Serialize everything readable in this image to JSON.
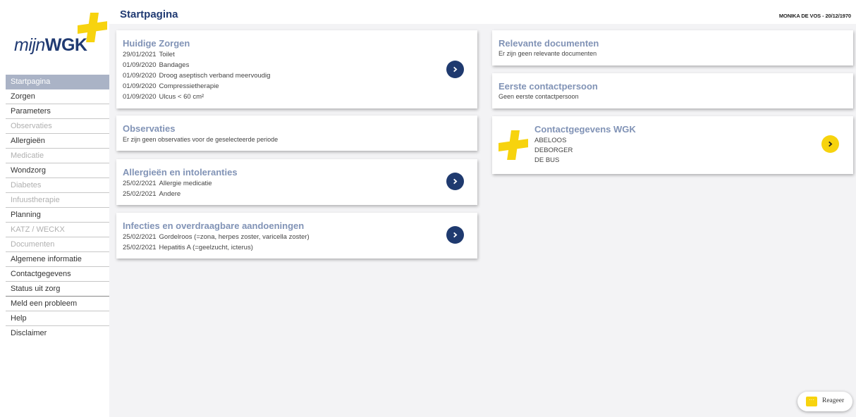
{
  "app": {
    "logo_prefix": "mijn",
    "logo_brand": "WGK"
  },
  "header": {
    "title": "Startpagina",
    "patient": "MONIKA DE VOS - 20/12/1970"
  },
  "sidebar": {
    "items": [
      {
        "label": "Startpagina"
      },
      {
        "label": "Zorgen"
      },
      {
        "label": "Parameters"
      },
      {
        "label": "Observaties"
      },
      {
        "label": "Allergieën"
      },
      {
        "label": "Medicatie"
      },
      {
        "label": "Wondzorg"
      },
      {
        "label": "Diabetes"
      },
      {
        "label": "Infuustherapie"
      },
      {
        "label": "Planning"
      },
      {
        "label": "KATZ / WECKX"
      },
      {
        "label": "Documenten"
      },
      {
        "label": "Algemene informatie"
      },
      {
        "label": "Contactgegevens"
      },
      {
        "label": "Status uit zorg"
      },
      {
        "label": "Meld een probleem"
      },
      {
        "label": "Help"
      },
      {
        "label": "Disclaimer"
      }
    ]
  },
  "cards": {
    "zorgen": {
      "title": "Huidige Zorgen",
      "rows": [
        {
          "date": "29/01/2021",
          "text": "Toilet"
        },
        {
          "date": "01/09/2020",
          "text": "Bandages"
        },
        {
          "date": "01/09/2020",
          "text": "Droog aseptisch verband meervoudig"
        },
        {
          "date": "01/09/2020",
          "text": "Compressietherapie"
        },
        {
          "date": "01/09/2020",
          "text": "Ulcus < 60 cm²"
        }
      ]
    },
    "observaties": {
      "title": "Observaties",
      "empty": "Er zijn geen observaties voor de geselecteerde periode"
    },
    "allergieen": {
      "title": "Allergieën en intoleranties",
      "rows": [
        {
          "date": "25/02/2021",
          "text": "Allergie medicatie"
        },
        {
          "date": "25/02/2021",
          "text": "Andere"
        }
      ]
    },
    "infecties": {
      "title": "Infecties en overdraagbare aandoeningen",
      "rows": [
        {
          "date": "25/02/2021",
          "text": "Gordelroos (=zona, herpes zoster, varicella zoster)"
        },
        {
          "date": "25/02/2021",
          "text": "Hepatitis A (=geelzucht, icterus)"
        }
      ]
    },
    "documenten": {
      "title": "Relevante documenten",
      "empty": "Er zijn geen relevante documenten"
    },
    "contactpersoon": {
      "title": "Eerste contactpersoon",
      "empty": "Geen eerste contactpersoon"
    },
    "wgk": {
      "title": "Contactgegevens WGK",
      "lines": [
        "ABELOOS",
        "DEBORGER",
        "DE BUS"
      ]
    }
  },
  "feedback": {
    "label": "Reageer",
    "icon": "chat-icon"
  },
  "colors": {
    "brand_navy": "#203a72",
    "brand_yellow": "#f7d30e",
    "card_title": "#8193b6",
    "nav_active": "#aab3c6"
  }
}
